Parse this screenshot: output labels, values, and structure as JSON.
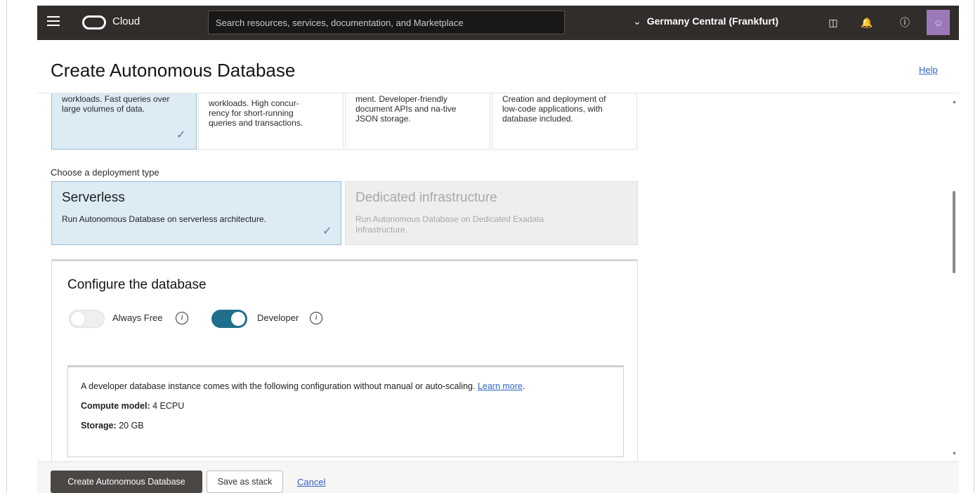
{
  "topbar": {
    "brand": "Cloud",
    "search_placeholder": "Search resources, services, documentation, and Marketplace",
    "region": "Germany Central (Frankfurt)"
  },
  "page": {
    "title": "Create Autonomous Database",
    "help": "Help"
  },
  "workload_cards": [
    {
      "text": "workloads. Fast queries over large volumes of data.",
      "selected": true
    },
    {
      "text": "workloads. High concur-rency for short-running queries and transactions.",
      "selected": false
    },
    {
      "text": "ment. Developer-friendly document APIs and na-tive JSON storage.",
      "selected": false
    },
    {
      "text": "Creation and deployment of low-code applications, with database included.",
      "selected": false
    }
  ],
  "deployment": {
    "label": "Choose a deployment type",
    "options": [
      {
        "title": "Serverless",
        "desc": "Run Autonomous Database on serverless architecture.",
        "selected": true
      },
      {
        "title": "Dedicated infrastructure",
        "desc": "Run Autonomous Database on Dedicated Exadata Infrastructure.",
        "selected": false
      }
    ]
  },
  "configure": {
    "heading": "Configure the database",
    "always_free": {
      "label": "Always Free",
      "on": false
    },
    "developer": {
      "label": "Developer",
      "on": true
    },
    "info": {
      "text": "A developer database instance comes with the following configuration without manual or auto-scaling.",
      "link": "Learn more",
      "compute_label": "Compute model:",
      "compute_value": "4 ECPU",
      "storage_label": "Storage:",
      "storage_value": "20 GB"
    }
  },
  "footer": {
    "create": "Create Autonomous Database",
    "save": "Save as stack",
    "cancel": "Cancel"
  }
}
